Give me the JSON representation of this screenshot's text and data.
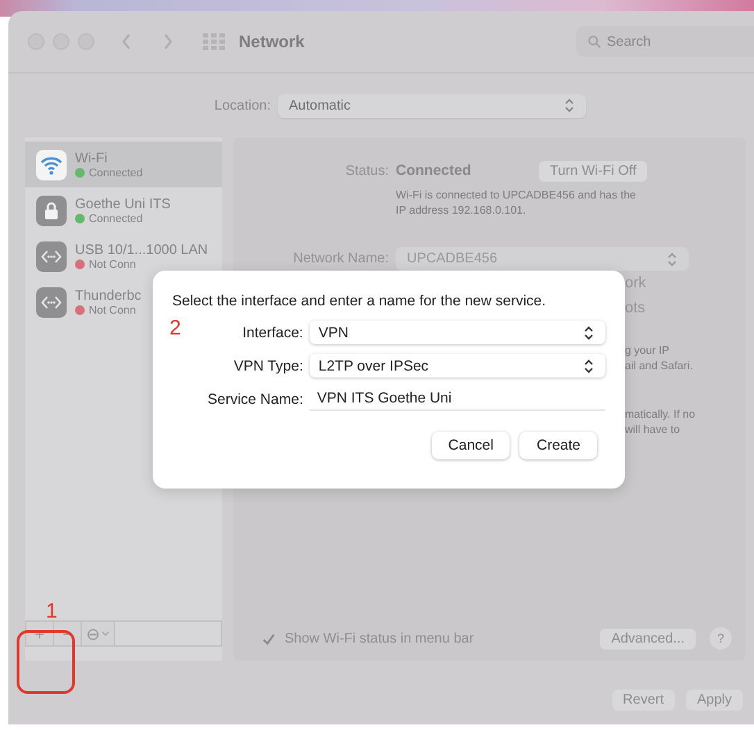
{
  "window": {
    "title": "Network",
    "search": {
      "placeholder": "Search"
    }
  },
  "location": {
    "label": "Location:",
    "value": "Automatic"
  },
  "sidebar": {
    "items": [
      {
        "name": "Wi-Fi",
        "status": "Connected",
        "connected": true,
        "selected": true,
        "kind": "wifi"
      },
      {
        "name": "Goethe Uni ITS",
        "status": "Connected",
        "connected": true,
        "selected": false,
        "kind": "vpn"
      },
      {
        "name": "USB 10/1...1000 LAN",
        "status": "Not Conn",
        "connected": false,
        "selected": false,
        "kind": "ethernet"
      },
      {
        "name": "Thunderbc",
        "status": "Not Conn",
        "connected": false,
        "selected": false,
        "kind": "ethernet"
      }
    ]
  },
  "sidebar_toolbar": {
    "add": "+",
    "remove": "−",
    "action": "⊖"
  },
  "detail": {
    "status_label": "Status:",
    "status_value": "Connected",
    "toggle_button": "Turn Wi-Fi Off",
    "description": "Wi-Fi is connected to UPCADBE456 and has the IP address 192.168.0.101.",
    "network_name_label": "Network Name:",
    "network_name_value": "UPCADBE456",
    "fragments": [
      [
        "ork",
        "ots"
      ],
      [
        "g your IP",
        "ail and Safari."
      ],
      [
        "matically. If no",
        "will have to"
      ]
    ],
    "show_status": {
      "label": "Show Wi-Fi status in menu bar",
      "checked": true
    },
    "advanced_button": "Advanced...",
    "help_button": "?"
  },
  "footer_buttons": [
    {
      "label": "Revert",
      "disabled": true
    },
    {
      "label": "Apply",
      "disabled": true
    }
  ],
  "dialog": {
    "prompt": "Select the interface and enter a name for the new service.",
    "fields": [
      {
        "label": "Interface:",
        "value": "VPN",
        "kind": "select"
      },
      {
        "label": "VPN Type:",
        "value": "L2TP over IPSec",
        "kind": "select"
      },
      {
        "label": "Service Name:",
        "value": "VPN ITS Goethe Uni",
        "kind": "text"
      }
    ],
    "buttons": [
      {
        "label": "Cancel",
        "default": false
      },
      {
        "label": "Create",
        "default": false
      }
    ]
  },
  "annotations": [
    {
      "label": "1"
    },
    {
      "label": "2"
    }
  ]
}
